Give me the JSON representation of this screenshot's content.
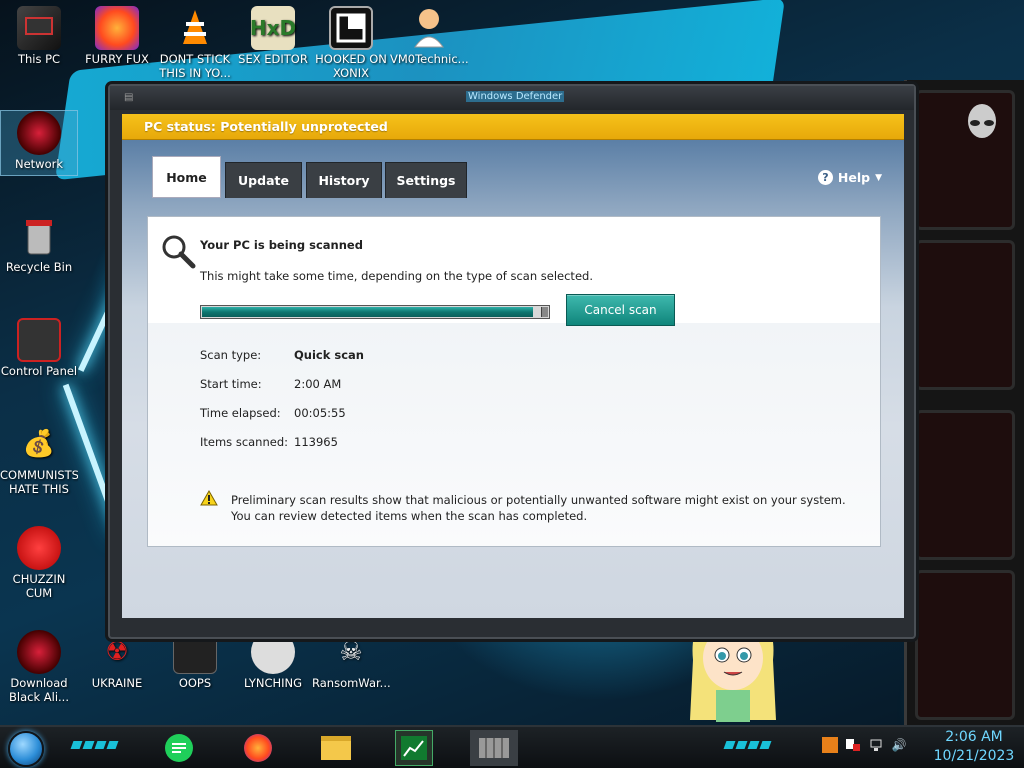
{
  "window": {
    "title": "Windows Defender",
    "status": "PC status: Potentially unprotected"
  },
  "tabs": [
    {
      "label": "Home",
      "active": true
    },
    {
      "label": "Update",
      "active": false
    },
    {
      "label": "History",
      "active": false
    },
    {
      "label": "Settings",
      "active": false
    }
  ],
  "help": {
    "label": "Help",
    "icon": "question-circle-icon"
  },
  "scan": {
    "title": "Your PC is being scanned",
    "description": "This might take some time, depending on the type of scan selected.",
    "progress_fraction": 0.98,
    "cancel_label": "Cancel scan",
    "details": [
      {
        "label": "Scan type:",
        "value": "Quick scan"
      },
      {
        "label": "Start time:",
        "value": "2:00 AM"
      },
      {
        "label": "Time elapsed:",
        "value": "00:05:55"
      },
      {
        "label": "Items scanned:",
        "value": "113965"
      }
    ],
    "warning_line1": "Preliminary scan results show that malicious or potentially unwanted software might exist on your system.",
    "warning_line2": "You can review detected items when the scan has completed."
  },
  "desktop_icons": [
    {
      "label": "This PC",
      "icon": "computer-icon"
    },
    {
      "label": "FURRY FUX",
      "icon": "firefox-icon"
    },
    {
      "label": "DONT STICK THIS IN YO...",
      "icon": "vlc-cone-icon"
    },
    {
      "label": "SEX EDITOR",
      "icon": "hxd-editor-icon"
    },
    {
      "label": "HOOKED ON XONIX",
      "icon": "game-icon"
    },
    {
      "label": "VM0Technic...",
      "icon": "doctor-icon"
    },
    {
      "label": "Network",
      "icon": "network-icon"
    },
    {
      "label": "Recycle Bin",
      "icon": "recycle-bin-icon"
    },
    {
      "label": "Control Panel",
      "icon": "control-panel-icon"
    },
    {
      "label": "COMMUNISTS HATE THIS G...",
      "icon": "money-bag-icon"
    },
    {
      "label": "CHUZZIN CUM",
      "icon": "chuzzle-icon"
    },
    {
      "label": "Download Black Ali...",
      "icon": "alienware-icon"
    },
    {
      "label": "UKRAINE",
      "icon": "radiation-icon"
    },
    {
      "label": "OOPS",
      "icon": "app-icon"
    },
    {
      "label": "LYNCHING",
      "icon": "app-icon"
    },
    {
      "label": "RansomWar...",
      "icon": "skull-icon"
    }
  ],
  "clock": {
    "time": "2:06 AM",
    "date": "10/21/2023"
  },
  "colors": {
    "status_bar": "#f0b514",
    "progress": "#0e7670",
    "cancel_button": "#1a958a",
    "clock_text": "#6fd7ff"
  }
}
